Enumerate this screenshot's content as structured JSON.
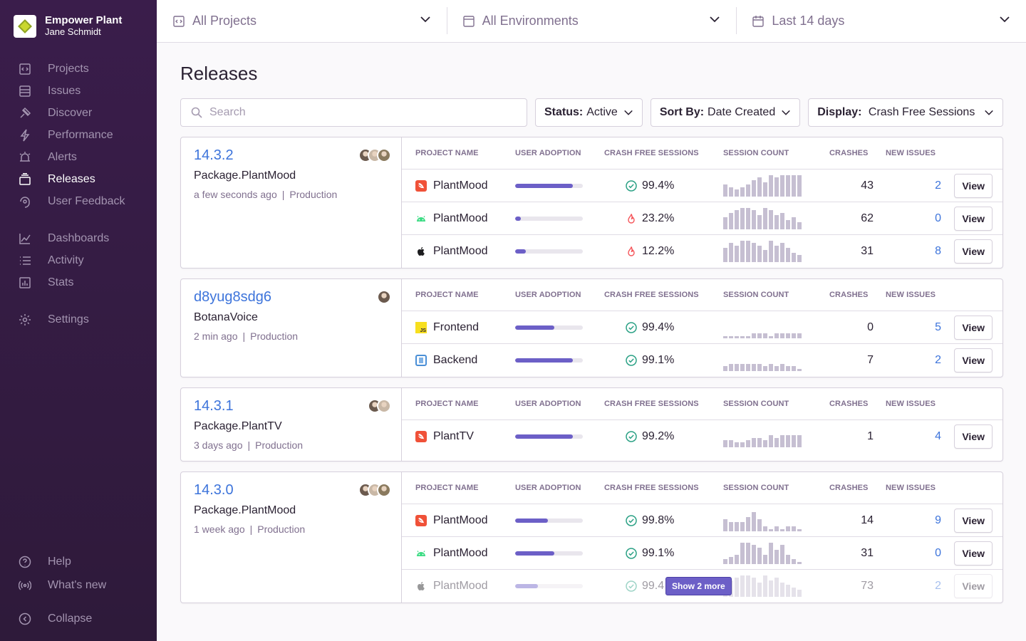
{
  "org": {
    "name": "Empower Plant",
    "user": "Jane Schmidt"
  },
  "nav": {
    "primary": [
      {
        "label": "Projects",
        "icon": "projects-icon"
      },
      {
        "label": "Issues",
        "icon": "issues-icon"
      },
      {
        "label": "Discover",
        "icon": "discover-icon"
      },
      {
        "label": "Performance",
        "icon": "performance-icon"
      },
      {
        "label": "Alerts",
        "icon": "alerts-icon"
      },
      {
        "label": "Releases",
        "icon": "releases-icon",
        "active": true
      },
      {
        "label": "User Feedback",
        "icon": "user-feedback-icon"
      }
    ],
    "secondary": [
      {
        "label": "Dashboards",
        "icon": "dashboards-icon"
      },
      {
        "label": "Activity",
        "icon": "activity-icon"
      },
      {
        "label": "Stats",
        "icon": "stats-icon"
      }
    ],
    "settings": {
      "label": "Settings",
      "icon": "settings-icon"
    },
    "footer": [
      {
        "label": "Help",
        "icon": "help-icon"
      },
      {
        "label": "What's new",
        "icon": "broadcast-icon"
      }
    ],
    "collapse": {
      "label": "Collapse",
      "icon": "collapse-icon"
    }
  },
  "topbar": {
    "projects": "All Projects",
    "environments": "All Environments",
    "period": "Last 14 days"
  },
  "page": {
    "title": "Releases"
  },
  "search": {
    "placeholder": "Search"
  },
  "filters": {
    "status": {
      "label": "Status:",
      "value": "Active"
    },
    "sort": {
      "label": "Sort By:",
      "value": "Date Created"
    },
    "display": {
      "label": "Display:",
      "value": "Crash Free Sessions"
    }
  },
  "columns": {
    "project": "Project Name",
    "adoption": "User Adoption",
    "crash_free": "Crash Free Sessions",
    "sessions": "Session Count",
    "crashes": "Crashes",
    "new_issues": "New Issues"
  },
  "view_label": "View",
  "show_more_label": "Show 2 more",
  "colors": {
    "accent": "#6c5fc7",
    "link": "#3d74db",
    "healthy": "#2ba185",
    "critical": "#f55459"
  },
  "releases": [
    {
      "version": "14.3.2",
      "package": "Package.PlantMood",
      "age": "a few seconds ago",
      "environment": "Production",
      "avatars": 3,
      "projects": [
        {
          "platform": "swift",
          "name": "PlantMood",
          "adoption": 0.85,
          "crash_free": "99.4%",
          "status": "healthy",
          "spark": [
            5,
            4,
            3,
            4,
            5,
            7,
            8,
            6,
            9,
            8,
            9,
            9,
            9,
            9
          ],
          "crashes": "43",
          "new_issues": "2"
        },
        {
          "platform": "android",
          "name": "PlantMood",
          "adoption": 0.08,
          "crash_free": "23.2%",
          "status": "critical",
          "spark": [
            5,
            7,
            8,
            9,
            9,
            8,
            6,
            9,
            8,
            6,
            7,
            4,
            5,
            3
          ],
          "crashes": "62",
          "new_issues": "0"
        },
        {
          "platform": "apple",
          "name": "PlantMood",
          "adoption": 0.16,
          "crash_free": "12.2%",
          "status": "critical",
          "spark": [
            6,
            8,
            7,
            9,
            9,
            8,
            7,
            5,
            9,
            7,
            8,
            6,
            4,
            3
          ],
          "crashes": "31",
          "new_issues": "8"
        }
      ]
    },
    {
      "version": "d8yug8sdg6",
      "package": "BotanaVoice",
      "age": "2 min ago",
      "environment": "Production",
      "avatars": 1,
      "projects": [
        {
          "platform": "js",
          "name": "Frontend",
          "adoption": 0.58,
          "crash_free": "99.4%",
          "status": "healthy",
          "spark": [
            1,
            1,
            1,
            1,
            1,
            2,
            2,
            2,
            1,
            2,
            2,
            2,
            2,
            2
          ],
          "crashes": "0",
          "new_issues": "5"
        },
        {
          "platform": "python",
          "name": "Backend",
          "adoption": 0.85,
          "crash_free": "99.1%",
          "status": "healthy",
          "spark": [
            2,
            3,
            3,
            3,
            3,
            3,
            3,
            2,
            3,
            2,
            3,
            2,
            2,
            1
          ],
          "crashes": "7",
          "new_issues": "2"
        }
      ]
    },
    {
      "version": "14.3.1",
      "package": "Package.PlantTV",
      "age": "3 days ago",
      "environment": "Production",
      "avatars": 2,
      "projects": [
        {
          "platform": "swift",
          "name": "PlantTV",
          "adoption": 0.85,
          "crash_free": "99.2%",
          "status": "healthy",
          "spark": [
            3,
            3,
            2,
            2,
            3,
            4,
            4,
            3,
            5,
            4,
            5,
            5,
            5,
            5
          ],
          "crashes": "1",
          "new_issues": "4"
        }
      ]
    },
    {
      "version": "14.3.0",
      "package": "Package.PlantMood",
      "age": "1 week ago",
      "environment": "Production",
      "avatars": 3,
      "projects": [
        {
          "platform": "swift",
          "name": "PlantMood",
          "adoption": 0.48,
          "crash_free": "99.8%",
          "status": "healthy",
          "spark": [
            5,
            4,
            4,
            4,
            6,
            8,
            5,
            2,
            1,
            2,
            1,
            2,
            2,
            1
          ],
          "crashes": "14",
          "new_issues": "9"
        },
        {
          "platform": "android",
          "name": "PlantMood",
          "adoption": 0.58,
          "crash_free": "99.1%",
          "status": "healthy",
          "spark": [
            2,
            3,
            4,
            9,
            9,
            8,
            7,
            4,
            9,
            6,
            8,
            4,
            2,
            1
          ],
          "crashes": "31",
          "new_issues": "0"
        },
        {
          "platform": "apple",
          "name": "PlantMood",
          "adoption": 0.34,
          "crash_free": "99.4",
          "status": "healthy",
          "faded": true,
          "spark": [
            5,
            7,
            8,
            9,
            9,
            8,
            6,
            9,
            7,
            8,
            6,
            5,
            4,
            3
          ],
          "crashes": "73",
          "new_issues": "2"
        }
      ]
    }
  ]
}
